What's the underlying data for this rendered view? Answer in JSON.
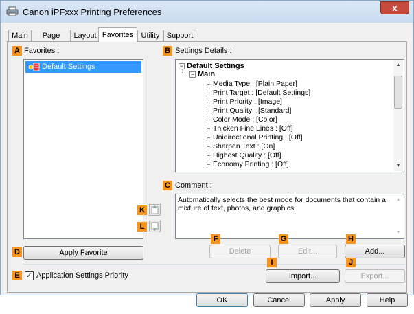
{
  "window": {
    "title": "Canon iPFxxx Printing Preferences",
    "close_label": "x"
  },
  "tabs": [
    {
      "label": "Main"
    },
    {
      "label": "Page Setup"
    },
    {
      "label": "Layout"
    },
    {
      "label": "Favorites"
    },
    {
      "label": "Utility"
    },
    {
      "label": "Support"
    }
  ],
  "active_tab": "Favorites",
  "markers": {
    "A": "A",
    "B": "B",
    "C": "C",
    "D": "D",
    "E": "E",
    "F": "F",
    "G": "G",
    "H": "H",
    "I": "I",
    "J": "J",
    "K": "K",
    "L": "L"
  },
  "favorites": {
    "label": "Favorites :",
    "items": [
      {
        "label": "Default Settings",
        "selected": true
      }
    ]
  },
  "settings_details": {
    "label": "Settings Details :",
    "root": "Default Settings",
    "group": "Main",
    "items": [
      "Media Type : [Plain Paper]",
      "Print Target : [Default Settings]",
      "Print Priority : [Image]",
      "Print Quality : [Standard]",
      "Color Mode : [Color]",
      "Thicken Fine Lines : [Off]",
      "Unidirectional Printing : [Off]",
      "Sharpen Text : [On]",
      "Highest Quality : [Off]",
      "Economy Printing : [Off]"
    ],
    "collapse_glyph": "−"
  },
  "comment": {
    "label": "Comment :",
    "text": "Automatically selects the best mode for documents that contain a mixture of text, photos, and graphics."
  },
  "buttons": {
    "apply_favorite": "Apply Favorite",
    "delete": "Delete",
    "edit": "Edit...",
    "add": "Add...",
    "import": "Import...",
    "export": "Export...",
    "ok": "OK",
    "cancel": "Cancel",
    "apply": "Apply",
    "help": "Help"
  },
  "app_settings_priority": {
    "label": "Application Settings Priority",
    "checked": true,
    "check_glyph": "✓"
  },
  "scroll_glyphs": {
    "up": "▲",
    "down": "▼"
  },
  "colors": {
    "marker": "#f7941d",
    "selection": "#3399ff",
    "close": "#c74b3c"
  }
}
